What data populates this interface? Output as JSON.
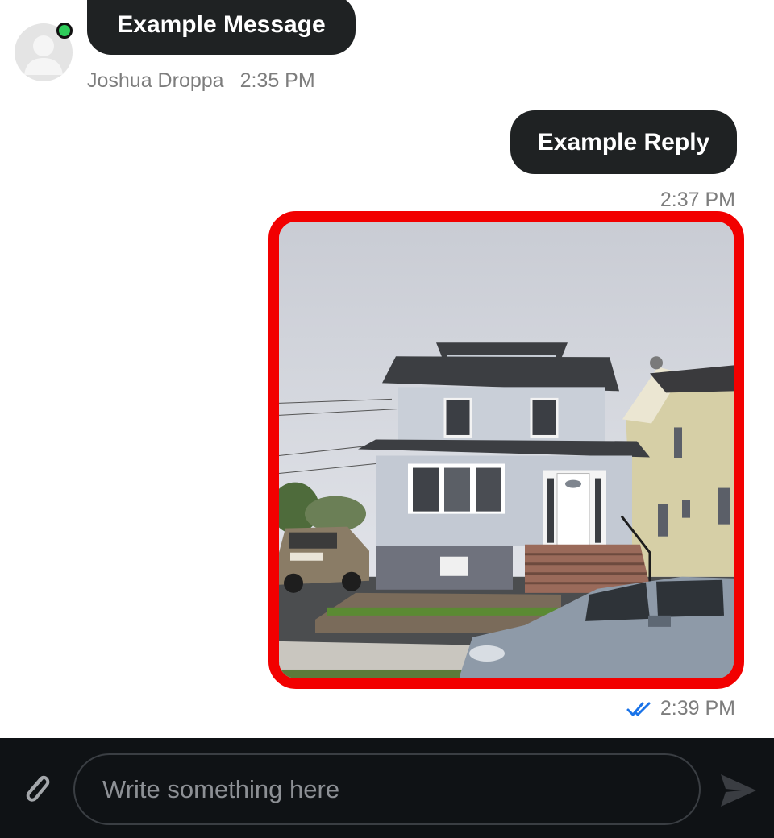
{
  "messages": [
    {
      "direction": "incoming",
      "text": "Example Message",
      "sender": "Joshua Droppa",
      "time": "2:35 PM",
      "online": true
    },
    {
      "direction": "outgoing",
      "text": "Example Reply",
      "time": "2:37 PM"
    },
    {
      "direction": "outgoing",
      "type": "image",
      "image_description": "Photo of a two-story house with gray siding, white door, and cars parked in front",
      "time": "2:39 PM",
      "read_status": "double-check-icon",
      "highlight_color": "#f20000"
    }
  ],
  "composer": {
    "placeholder": "Write something here",
    "attach_icon": "paperclip-icon",
    "send_icon": "send-icon"
  },
  "colors": {
    "bubble": "#1f2223",
    "online": "#2ecc5a",
    "read_check": "#1a73e8",
    "composer_bg": "#0f1215"
  }
}
